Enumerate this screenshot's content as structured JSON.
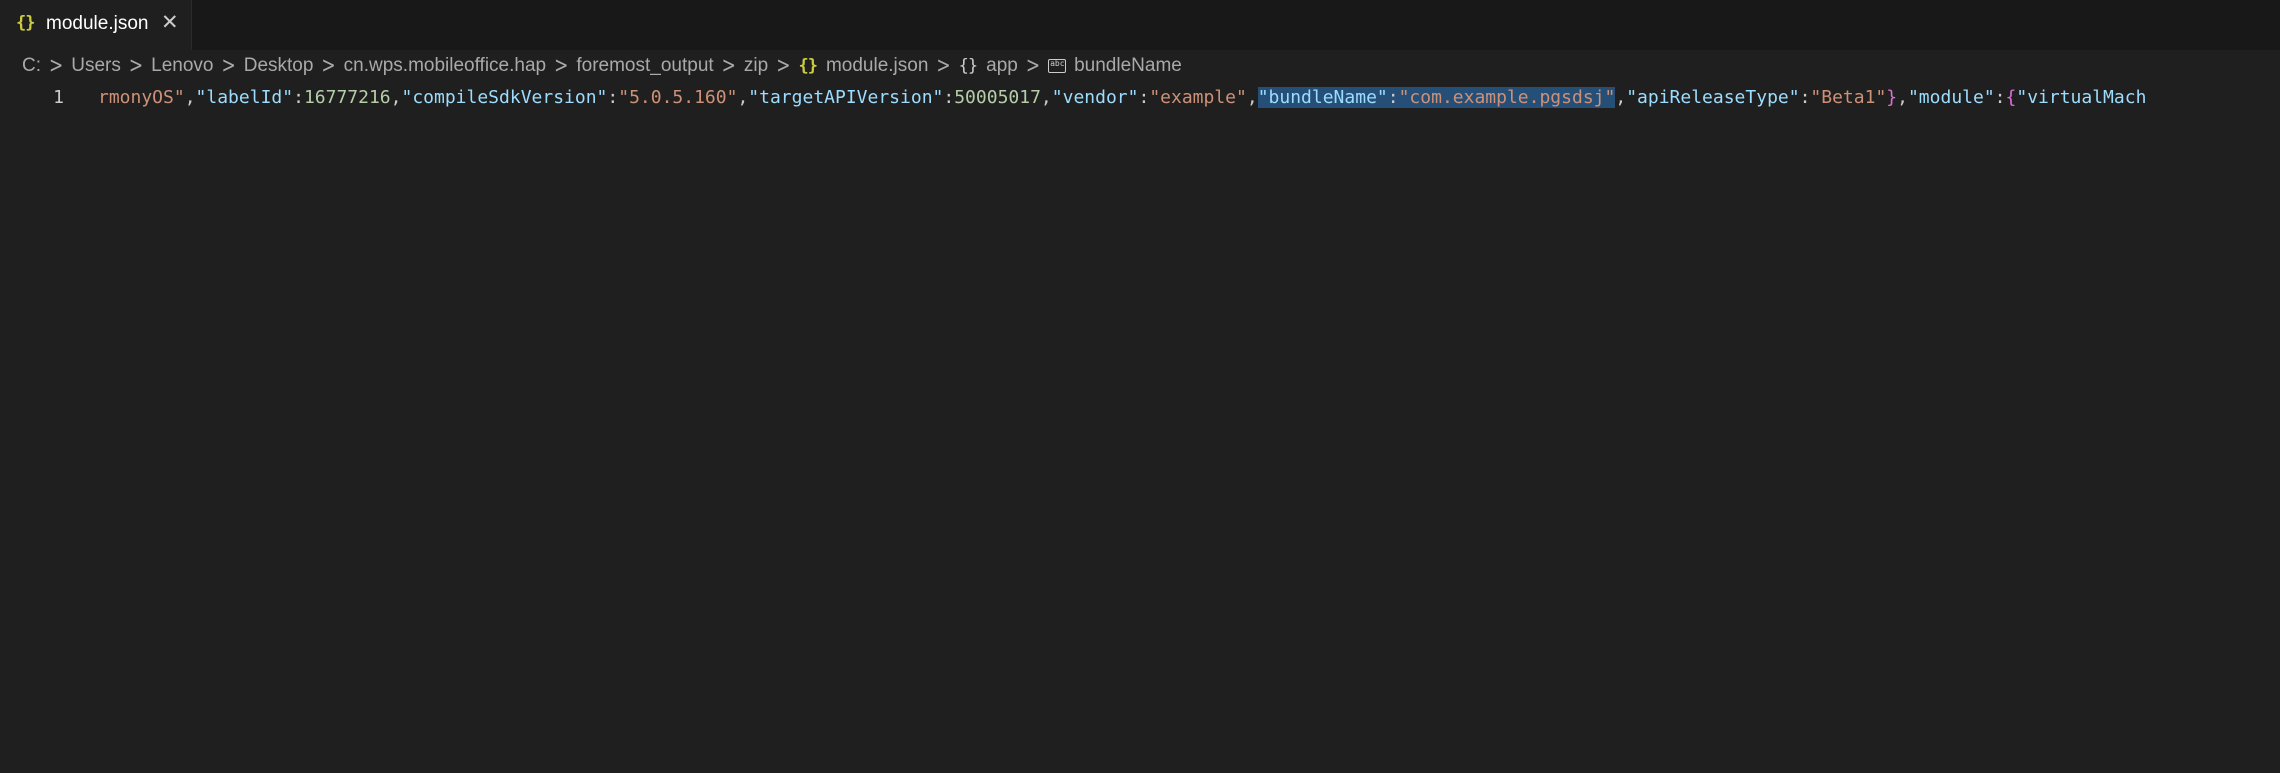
{
  "tab": {
    "icon": "json-braces-icon",
    "label": "module.json",
    "close": "✕",
    "icon_color": "#cbcb41"
  },
  "breadcrumb": {
    "items": [
      "C:",
      "Users",
      "Lenovo",
      "Desktop",
      "cn.wps.mobileoffice.hap",
      "foremost_output",
      "zip",
      "module.json",
      "app",
      "bundleName"
    ],
    "icons": {
      "module.json": "json-braces-icon",
      "app": "object-braces-icon",
      "bundleName": "string-property-icon"
    }
  },
  "editor": {
    "line_number": "1",
    "tokens": [
      {
        "t": "str",
        "v": "rmonyOS\""
      },
      {
        "t": "punc",
        "v": ","
      },
      {
        "t": "key",
        "v": "\"labelId\""
      },
      {
        "t": "punc",
        "v": ":"
      },
      {
        "t": "num",
        "v": "16777216"
      },
      {
        "t": "punc",
        "v": ","
      },
      {
        "t": "key",
        "v": "\"compileSdkVersion\""
      },
      {
        "t": "punc",
        "v": ":"
      },
      {
        "t": "str",
        "v": "\"5.0.5.160\""
      },
      {
        "t": "punc",
        "v": ","
      },
      {
        "t": "key",
        "v": "\"targetAPIVersion\""
      },
      {
        "t": "punc",
        "v": ":"
      },
      {
        "t": "num",
        "v": "50005017"
      },
      {
        "t": "punc",
        "v": ","
      },
      {
        "t": "key",
        "v": "\"vendor\""
      },
      {
        "t": "punc",
        "v": ":"
      },
      {
        "t": "str",
        "v": "\"example\""
      },
      {
        "t": "punc",
        "v": ","
      },
      {
        "t": "key",
        "v": "\"bundleName\"",
        "sel": true
      },
      {
        "t": "punc",
        "v": ":",
        "sel": true
      },
      {
        "t": "str",
        "v": "\"com.example.pgsdsj\"",
        "sel": true
      },
      {
        "t": "punc",
        "v": ","
      },
      {
        "t": "key",
        "v": "\"apiReleaseType\""
      },
      {
        "t": "punc",
        "v": ":"
      },
      {
        "t": "str",
        "v": "\"Beta1\""
      },
      {
        "t": "brace",
        "v": "}"
      },
      {
        "t": "punc",
        "v": ","
      },
      {
        "t": "key",
        "v": "\"module\""
      },
      {
        "t": "punc",
        "v": ":"
      },
      {
        "t": "brace",
        "v": "{"
      },
      {
        "t": "key",
        "v": "\"virtualMach"
      }
    ]
  },
  "colors": {
    "background": "#1f1f1f",
    "tabbar": "#181818",
    "string": "#ce9178",
    "key": "#9cdcfe",
    "number": "#b5cea8",
    "brace": "#da70d6",
    "selection": "#264f78"
  }
}
